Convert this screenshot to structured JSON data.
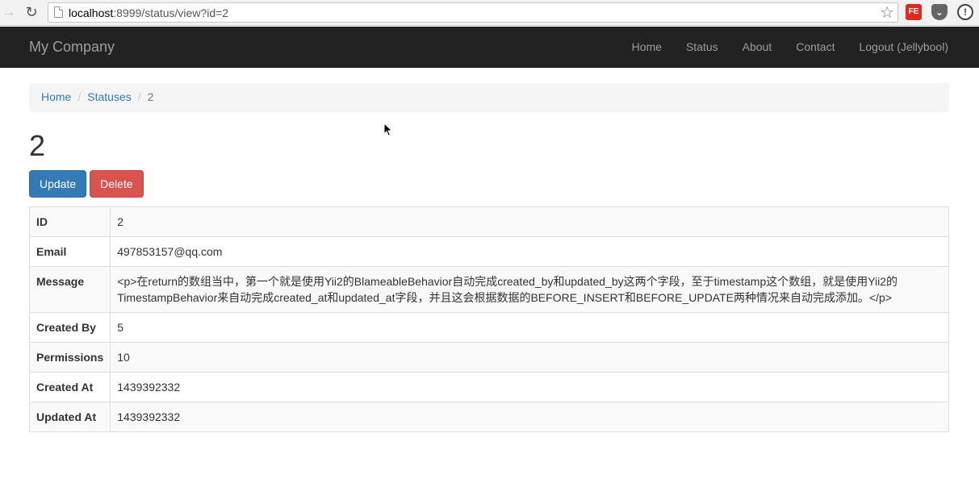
{
  "browser": {
    "url_host": "localhost",
    "url_rest": ":8999/status/view?id=2",
    "extensions": [
      "FE",
      "pocket",
      "info"
    ]
  },
  "navbar": {
    "brand": "My Company",
    "links": [
      "Home",
      "Status",
      "About",
      "Contact",
      "Logout (Jellybool)"
    ]
  },
  "breadcrumb": {
    "items": [
      "Home",
      "Statuses"
    ],
    "active": "2",
    "separator": "/"
  },
  "page": {
    "title": "2",
    "update_label": "Update",
    "delete_label": "Delete"
  },
  "detail_rows": [
    {
      "label": "ID",
      "value": "2"
    },
    {
      "label": "Email",
      "value": "497853157@qq.com"
    },
    {
      "label": "Message",
      "value": "<p>在return的数组当中，第一个就是使用Yii2的BlameableBehavior自动完成created_by和updated_by这两个字段，至于timestamp这个数组，就是使用Yii2的TimestampBehavior来自动完成created_at和updated_at字段，并且这会根据数据的BEFORE_INSERT和BEFORE_UPDATE两种情况来自动完成添加。</p>"
    },
    {
      "label": "Created By",
      "value": "5"
    },
    {
      "label": "Permissions",
      "value": "10"
    },
    {
      "label": "Created At",
      "value": "1439392332"
    },
    {
      "label": "Updated At",
      "value": "1439392332"
    }
  ],
  "colors": {
    "navbar_bg": "#222222",
    "link": "#337ab7",
    "primary": "#337ab7",
    "danger": "#d9534f"
  }
}
